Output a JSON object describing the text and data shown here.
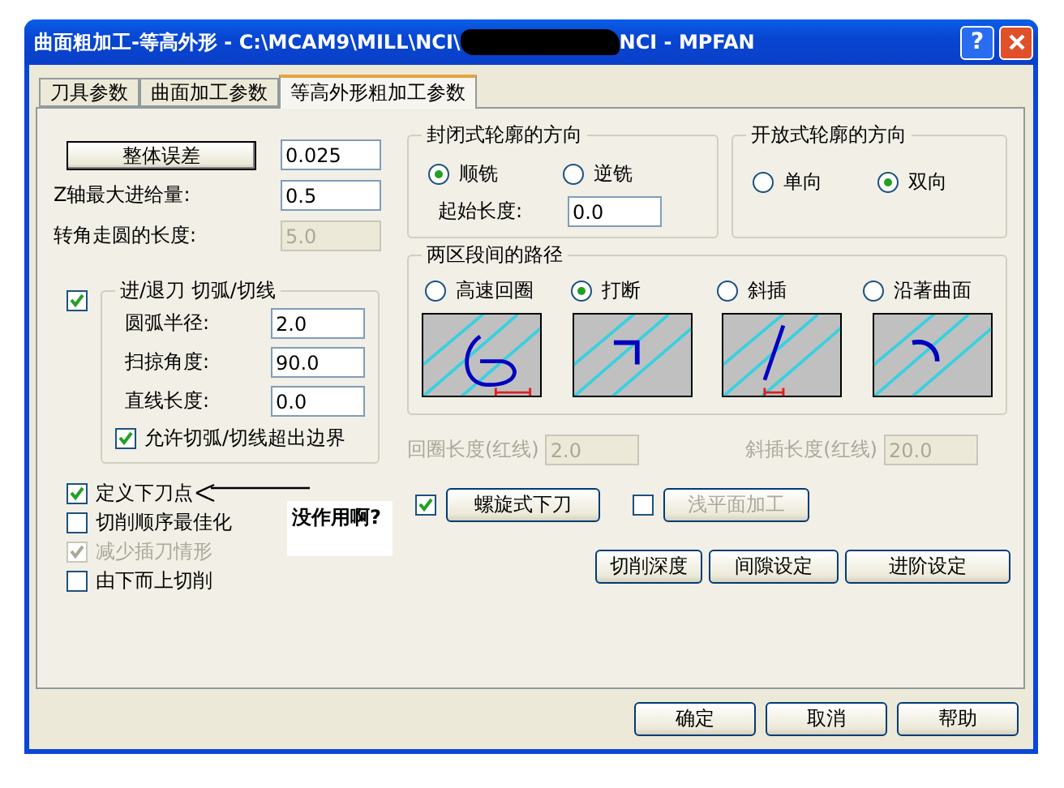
{
  "window": {
    "title": "曲面粗加工-等高外形 - C:\\MCAM9\\MILL\\NCI\\",
    "title_redacted": true,
    "title_tail": "NCI - MPFAN",
    "help": "?"
  },
  "tabs": [
    {
      "label": "刀具参数",
      "selected": false
    },
    {
      "label": "曲面加工参数",
      "selected": false
    },
    {
      "label": "等高外形粗加工参数",
      "selected": true
    }
  ],
  "tolerance": {
    "button": "整体误差",
    "value": "0.025"
  },
  "fields": [
    {
      "label": "Z轴最大进给量:",
      "value": "0.5",
      "disabled": false
    },
    {
      "label": "转角走圆的长度:",
      "value": "5.0",
      "disabled": true
    }
  ],
  "lead_in_out": {
    "checked": true,
    "title": "进/退刀 切弧/切线",
    "fields": [
      {
        "label": "圆弧半径:",
        "value": "2.0"
      },
      {
        "label": "扫掠角度:",
        "value": "90.0"
      },
      {
        "label": "直线长度:",
        "value": "0.0"
      }
    ],
    "allow": {
      "label": "允许切弧/切线超出边界",
      "checked": true
    }
  },
  "closed_direction": {
    "title": "封闭式轮廓的方向",
    "options": [
      {
        "label": "顺铣",
        "selected": true
      },
      {
        "label": "逆铣",
        "selected": false
      }
    ],
    "start_length": {
      "label": "起始长度:",
      "value": "0.0"
    }
  },
  "open_direction": {
    "title": "开放式轮廓的方向",
    "options": [
      {
        "label": "单向",
        "selected": false
      },
      {
        "label": "双向",
        "selected": true
      }
    ]
  },
  "transition": {
    "title": "两区段间的路径",
    "options": [
      {
        "label": "高速回圈",
        "selected": false,
        "kind": "loop"
      },
      {
        "label": "打断",
        "selected": true,
        "kind": "break"
      },
      {
        "label": "斜插",
        "selected": false,
        "kind": "ramp"
      },
      {
        "label": "沿著曲面",
        "selected": false,
        "kind": "surface"
      }
    ],
    "lengths": [
      {
        "label": "回圈长度(红线)",
        "value": "2.0",
        "disabled": true
      },
      {
        "label": "斜插长度(红线)",
        "value": "20.0",
        "disabled": true
      }
    ]
  },
  "options": [
    {
      "label": "定义下刀点",
      "checked": true,
      "disabled": false
    },
    {
      "label": "切削顺序最佳化",
      "checked": false,
      "disabled": false
    },
    {
      "label": "减少插刀情形",
      "checked": true,
      "disabled": true
    },
    {
      "label": "由下而上切削",
      "checked": false,
      "disabled": false
    }
  ],
  "note": "没作用啊?",
  "helix": {
    "checked": true,
    "label": "螺旋式下刀"
  },
  "shallow": {
    "checked": false,
    "label": "浅平面加工",
    "disabled": true
  },
  "buttons": [
    "切削深度",
    "间隙设定",
    "进阶设定"
  ],
  "footer_buttons": [
    "确定",
    "取消",
    "帮助"
  ]
}
